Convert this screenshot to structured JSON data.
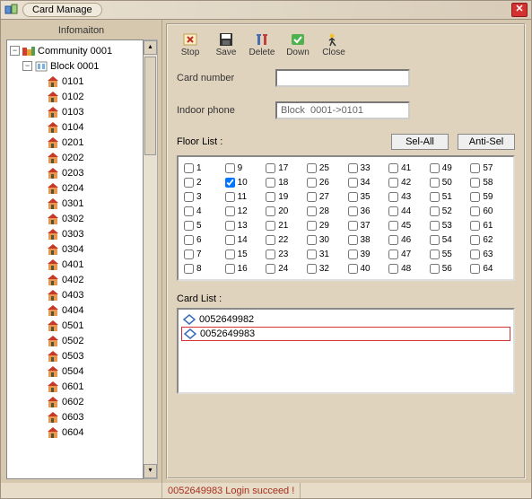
{
  "title": "Card Manage",
  "info_label": "Infomaiton",
  "tree": {
    "root": "Community 0001",
    "block": "Block  0001",
    "rooms": [
      "0101",
      "0102",
      "0103",
      "0104",
      "0201",
      "0202",
      "0203",
      "0204",
      "0301",
      "0302",
      "0303",
      "0304",
      "0401",
      "0402",
      "0403",
      "0404",
      "0501",
      "0502",
      "0503",
      "0504",
      "0601",
      "0602",
      "0603",
      "0604"
    ]
  },
  "toolbar": {
    "stop": "Stop",
    "save": "Save",
    "delete": "Delete",
    "down": "Down",
    "close": "Close"
  },
  "form": {
    "card_number_label": "Card number",
    "card_number_value": "",
    "indoor_phone_label": "Indoor phone",
    "indoor_phone_value": "Block  0001->0101"
  },
  "floor": {
    "label": "Floor List :",
    "sel_all": "Sel-All",
    "anti_sel": "Anti-Sel",
    "checked": [
      10
    ]
  },
  "cardlist": {
    "label": "Card  List :",
    "items": [
      "0052649982",
      "0052649983"
    ],
    "selected": 1
  },
  "status": "0052649983 Login succeed !"
}
